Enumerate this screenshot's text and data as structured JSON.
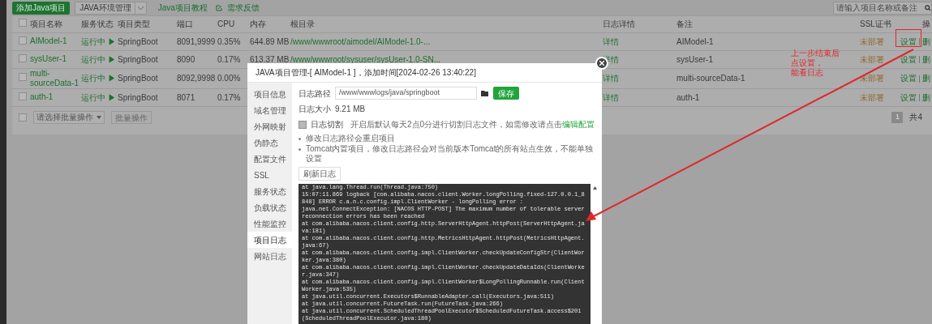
{
  "toolbar": {
    "add_button": "添加Java项目",
    "env_button": "JAVA环境管理",
    "tutorial_link": "Java项目教程",
    "feedback_link": "需求反馈",
    "search": {
      "placeholder": "请输入项目名称或备注"
    }
  },
  "table": {
    "header_checked": false,
    "columns": [
      "项目名称",
      "服务状态",
      "项目类型",
      "端口",
      "CPU",
      "内存",
      "根目录",
      "日志详情",
      "备注",
      "SSL证书",
      "操"
    ],
    "rows": [
      {
        "checked": false,
        "name": "AIModel-1",
        "status": "运行中 ▶",
        "type": "SpringBoot",
        "port": "8091,9999",
        "cpu": "0.35%",
        "memory": "644.89 MB",
        "root": "/www/wwwroot/aimodel/AIModel-1.0-...",
        "log": "详情",
        "note": "AIModel-1",
        "ssl": "未部署",
        "actions": [
          "设置",
          "删"
        ]
      },
      {
        "checked": false,
        "name": "sysUser-1",
        "status": "运行中 ▶",
        "type": "SpringBoot",
        "port": "8090",
        "cpu": "0.17%",
        "memory": "613.37 MB",
        "root": "/www/wwwroot/sysuser/sysUser-1.0-SN...",
        "log": "详情",
        "note": "sysUser-1",
        "ssl": "未部署",
        "actions": [
          "设置",
          "删"
        ]
      },
      {
        "checked": false,
        "name": "multi-sourceData-1",
        "status": "运行中 ▶",
        "type": "SpringBoot",
        "port": "8092,9998",
        "cpu": "0.00%",
        "log": "详情",
        "note": "multi-sourceData-1",
        "ssl": "未部署",
        "actions": [
          "设置",
          "删"
        ]
      },
      {
        "checked": false,
        "name": "auth-1",
        "status": "运行中 ▶",
        "type": "SpringBoot",
        "port": "8071",
        "cpu": "0.17%",
        "log": "详情",
        "note": "auth-1",
        "ssl": "未部署",
        "actions": [
          "设置",
          "删"
        ]
      }
    ]
  },
  "bulk": {
    "checked": false,
    "select": "请选择批量操作",
    "button": "批量操作"
  },
  "pagination": {
    "pages": [
      {
        "label": "1",
        "selected": true
      }
    ],
    "total": "共4"
  },
  "modal": {
    "title": "JAVA项目管理-[ AIModel-1 ]，添加时间[2024-02-26 13:40:22]",
    "tabs": [
      {
        "label": "项目信息",
        "selected": false
      },
      {
        "label": "域名管理",
        "selected": false
      },
      {
        "label": "外网映射",
        "selected": false
      },
      {
        "label": "伪静态",
        "selected": false
      },
      {
        "label": "配置文件",
        "selected": false
      },
      {
        "label": "SSL",
        "selected": false
      },
      {
        "label": "服务状态",
        "selected": false
      },
      {
        "label": "负载状态",
        "selected": false
      },
      {
        "label": "性能监控",
        "selected": false
      },
      {
        "label": "项目日志",
        "selected": true
      },
      {
        "label": "网站日志",
        "selected": false
      }
    ],
    "log_path": {
      "label": "日志路径",
      "value": "/www/wwwlogs/java/springboot"
    },
    "save_button": "保存",
    "log_size": {
      "label": "日志大小",
      "value": "9.21 MB"
    },
    "log_split": {
      "label": "日志切割",
      "checked": false,
      "hint": "开启后默认每天2点0分进行切割日志文件，如需修改请点击",
      "link": "编辑配置"
    },
    "notes": [
      "修改日志路径会重启项目",
      "Tomcat内置项目，修改日志路径会对当前版本Tomcat的所有站点生效，不能单独设置"
    ],
    "refresh_button": "刷新日志",
    "log_lines": [
      "at java.lang.Thread.run(Thread.java:750)",
      "15:07:11.869 logback [com.alibaba.nacos.client.Worker.longPolling.fixed-127.0.0.1_8848] ERROR c.a.n.c.config.impl.ClientWorker - longPolling error :",
      "java.net.ConnectException: [NACOS HTTP-POST] The maximum number of tolerable server reconnection errors has been reached",
      "at com.alibaba.nacos.client.config.http.ServerHttpAgent.httpPost(ServerHttpAgent.java:181)",
      "at com.alibaba.nacos.client.config.http.MetricsHttpAgent.httpPost(MetricsHttpAgent.java:67)",
      "at com.alibaba.nacos.client.config.impl.ClientWorker.checkUpdateConfigStr(ClientWorker.java:380)",
      "at com.alibaba.nacos.client.config.impl.ClientWorker.checkUpdateDataIds(ClientWorker.java:347)",
      "at com.alibaba.nacos.client.config.impl.ClientWorker$LongPollingRunnable.run(ClientWorker.java:535)",
      "at java.util.concurrent.Executors$RunnableAdapter.call(Executors.java:511)",
      "at java.util.concurrent.FutureTask.run(FutureTask.java:266)",
      "at java.util.concurrent.ScheduledThreadPoolExecutor$ScheduledFutureTask.access$201(ScheduledThreadPoolExecutor.java:180)"
    ]
  },
  "annotation": {
    "lines": [
      "上一步结束后",
      "点设置，",
      "能看日志"
    ]
  }
}
